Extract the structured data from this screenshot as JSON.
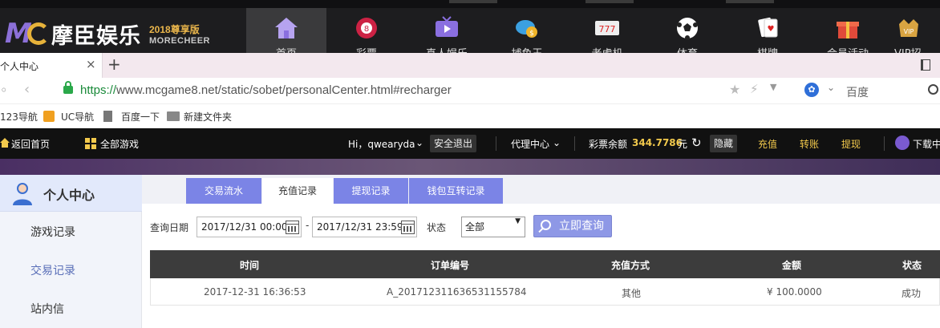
{
  "site": {
    "brand": "摩臣娱乐",
    "brand_sub_year": "2018尊享版",
    "brand_sub_en": "MORECHEER",
    "nav": [
      {
        "label": "首页",
        "icon": "home-icon"
      },
      {
        "label": "彩票",
        "icon": "lottery-ball-icon"
      },
      {
        "label": "真人娱乐",
        "icon": "tv-icon"
      },
      {
        "label": "捕鱼王",
        "icon": "fish-coin-icon"
      },
      {
        "label": "老虎机",
        "icon": "slot-machine-icon"
      },
      {
        "label": "体育",
        "icon": "soccer-ball-icon"
      },
      {
        "label": "棋牌",
        "icon": "playing-cards-icon"
      },
      {
        "label": "会员活动",
        "icon": "gift-box-icon"
      },
      {
        "label": "VIP招",
        "icon": "vip-crown-icon"
      }
    ]
  },
  "browser": {
    "tab_title": "个人中心",
    "tab_close": "×",
    "new_tab": "+",
    "url_proto": "https://",
    "url_rest": "www.mcgame8.net/static/sobet/personalCenter.html#recharger",
    "search_engine": "百度",
    "bookmarks": [
      "123导航",
      "UC导航",
      "百度一下",
      "新建文件夹"
    ]
  },
  "userbar": {
    "home_link": "返回首页",
    "all_games": "全部游戏",
    "greeting": "Hi，qwearyda",
    "logout": "安全退出",
    "agent_center": "代理中心",
    "balance_label": "彩票余额",
    "balance_value": "344.7786",
    "balance_unit": "元",
    "hide": "隐藏",
    "recharge": "充值",
    "transfer": "转账",
    "withdraw": "提现",
    "download": "下载中"
  },
  "sidebar": {
    "title": "个人中心",
    "items": [
      {
        "label": "游戏记录"
      },
      {
        "label": "交易记录"
      },
      {
        "label": "站内信"
      }
    ]
  },
  "main": {
    "tabs": [
      {
        "label": "交易流水"
      },
      {
        "label": "充值记录"
      },
      {
        "label": "提现记录"
      },
      {
        "label": "钱包互转记录"
      }
    ],
    "filter": {
      "date_label": "查询日期",
      "start_date": "2017/12/31 00:00",
      "end_date": "2017/12/31 23:59",
      "date_sep": "-",
      "status_label": "状态",
      "status_value": "全部",
      "query_button": "立即查询"
    },
    "table": {
      "headers": [
        "时间",
        "订单编号",
        "充值方式",
        "金额",
        "状态"
      ],
      "rows": [
        [
          "2017-12-31 16:36:53",
          "A_20171231163653115​5784",
          "其他",
          "¥ 100.0000",
          "成功"
        ]
      ]
    }
  }
}
